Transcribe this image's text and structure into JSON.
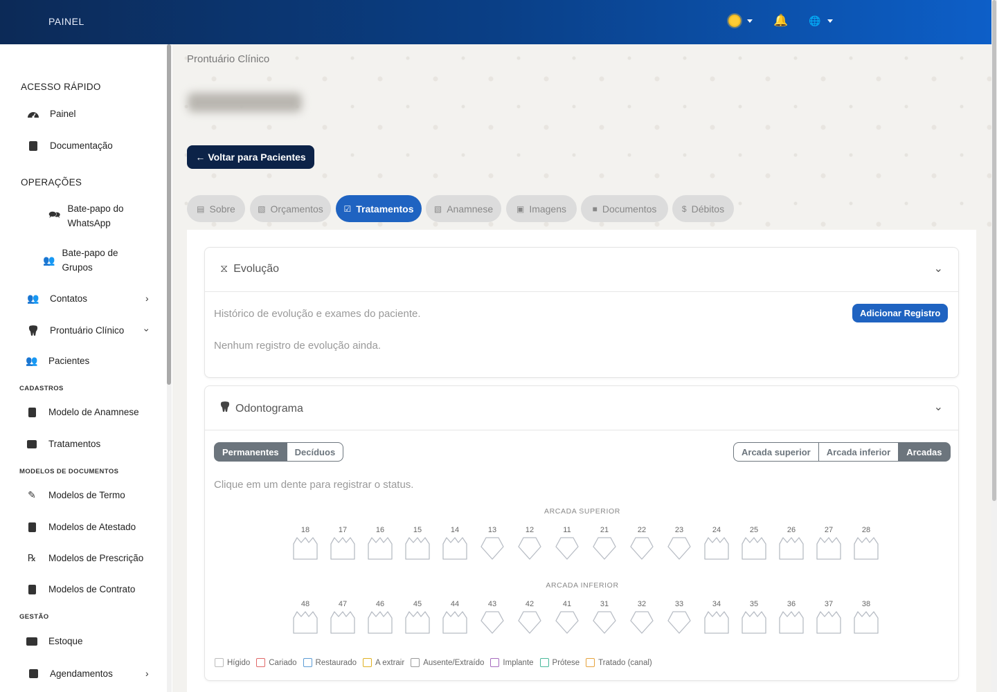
{
  "topbar": {
    "brand": "PAINEL",
    "icons": [
      "sun-icon",
      "bell-icon",
      "globe-icon"
    ]
  },
  "sidebar": {
    "quick_access_title": "ACESSO RÁPIDO",
    "painel": "Painel",
    "documentacao": "Documentação",
    "operations_title": "OPERAÇÕES",
    "whatsapp": "Bate-papo do WhatsApp",
    "grupos": "Bate-papo de Grupos",
    "contatos": "Contatos",
    "prontuario": "Prontuário Clínico",
    "pacientes": "Pacientes",
    "cadastros_title": "CADASTROS",
    "modelo_anamnese": "Modelo de Anamnese",
    "tratamentos": "Tratamentos",
    "modelos_documentos_title": "MODELOS DE DOCUMENTOS",
    "modelos_termo": "Modelos de Termo",
    "modelos_atestado": "Modelos de Atestado",
    "modelos_prescricao": "Modelos de Prescrição",
    "modelos_contrato": "Modelos de Contrato",
    "gestao_title": "GESTÃO",
    "estoque": "Estoque",
    "agendamentos": "Agendamentos"
  },
  "main": {
    "breadcrumb": "Prontuário Clínico",
    "back_label": "Voltar para Pacientes",
    "tabs": [
      {
        "label": "Sobre",
        "active": false
      },
      {
        "label": "Orçamentos",
        "active": false
      },
      {
        "label": "Tratamentos",
        "active": true
      },
      {
        "label": "Anamnese",
        "active": false
      },
      {
        "label": "Imagens",
        "active": false
      },
      {
        "label": "Documentos",
        "active": false
      },
      {
        "label": "Débitos",
        "active": false
      }
    ]
  },
  "evolucao": {
    "title": "Evolução",
    "description": "Histórico de evolução e exames do paciente.",
    "add_button": "Adicionar Registro",
    "empty": "Nenhum registro de evolução ainda."
  },
  "odontograma": {
    "title": "Odontograma",
    "dentition": {
      "permanentes": "Permanentes",
      "deciduos": "Decíduos",
      "selected": "Permanentes"
    },
    "arch_view": {
      "superior": "Arcada superior",
      "inferior": "Arcada inferior",
      "arcadas": "Arcadas",
      "selected": "Arcadas"
    },
    "hint": "Clique em um dente para registrar o status.",
    "upper_label": "ARCADA SUPERIOR",
    "lower_label": "ARCADA INFERIOR",
    "upper_teeth": [
      "18",
      "17",
      "16",
      "15",
      "14",
      "13",
      "12",
      "11",
      "21",
      "22",
      "23",
      "24",
      "25",
      "26",
      "27",
      "28"
    ],
    "lower_teeth": [
      "48",
      "47",
      "46",
      "45",
      "44",
      "43",
      "42",
      "41",
      "31",
      "32",
      "33",
      "34",
      "35",
      "36",
      "37",
      "38"
    ],
    "legend": [
      {
        "label": "Hígido",
        "color": "#bbbbbb"
      },
      {
        "label": "Cariado",
        "color": "#e06666"
      },
      {
        "label": "Restaurado",
        "color": "#5b9bd5"
      },
      {
        "label": "A extrair",
        "color": "#e0b020"
      },
      {
        "label": "Ausente/Extraído",
        "color": "#999999"
      },
      {
        "label": "Implante",
        "color": "#a569bd"
      },
      {
        "label": "Prótese",
        "color": "#48b89a"
      },
      {
        "label": "Tratado (canal)",
        "color": "#e6a23c"
      }
    ]
  }
}
